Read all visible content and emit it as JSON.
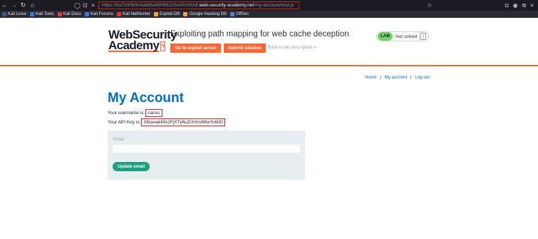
{
  "browser": {
    "url": {
      "scheme": "https://",
      "subdomain": "0a7200b004a9d5a98096120e00c000df.",
      "host": "web-security-academy.net",
      "path": "/my-account/wcd.js"
    },
    "bookmarks": [
      {
        "label": "Kali Linux",
        "color": "#3f5a8a"
      },
      {
        "label": "Kali Tools",
        "color": "#367bf0"
      },
      {
        "label": "Kali Docs",
        "color": "#e53935"
      },
      {
        "label": "Kali Forums",
        "color": "#367bf0"
      },
      {
        "label": "Kali NetHunter",
        "color": "#e53935"
      },
      {
        "label": "Exploit-DB",
        "color": "#f4a340"
      },
      {
        "label": "Google Hacking DB",
        "color": "#f4a340"
      },
      {
        "label": "OffSec",
        "color": "#5a7bd6"
      }
    ]
  },
  "lab": {
    "logo_line1": "WebSecurity",
    "logo_line2": "Academy",
    "logo_bolt": "ϟ",
    "title": "Exploiting path mapping for web cache deception",
    "exploit_button": "Go to exploit server",
    "submit_button": "Submit solution",
    "back_link": "Back to lab description »",
    "status_pill": "LAB",
    "status_text": "Not solved"
  },
  "nav": {
    "home": "Home",
    "sep": "|",
    "my_account": "My account",
    "logout": "Log out"
  },
  "account": {
    "title": "My Account",
    "username_prefix": "Your username is:",
    "username": "carlos",
    "apikey_prefix": "Your API Key is:",
    "apikey": "XlbswakMA2FjXTy6uZiXXroMlwYo6iID",
    "email_label": "Email",
    "email_value": "",
    "update_button": "Update email"
  },
  "colors": {
    "accent_orange": "#ff6633",
    "link_blue": "#0071bc",
    "button_green": "#1d9e7c",
    "highlight_red": "#d21f1f"
  }
}
